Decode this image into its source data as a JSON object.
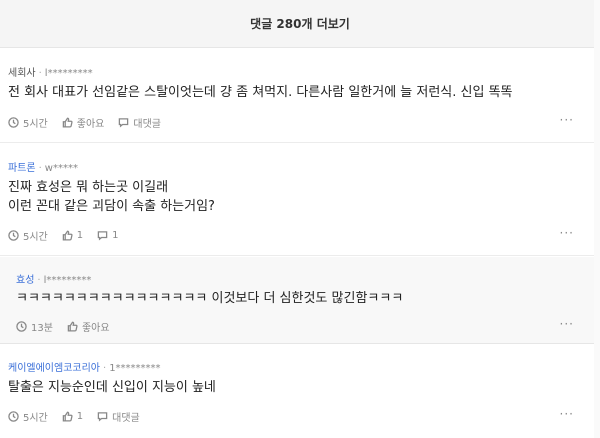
{
  "more_label": "댓글 280개 더보기",
  "comments": [
    {
      "company": "세회사",
      "user": "l*********",
      "lines": [
        "전 회사 대표가 선임같은 스탈이엇는데 걍 좀 쳐먹지. 다른사람 일한거에 늘 저런식. 신입 똑똑"
      ],
      "time": "5시간",
      "like": "좋아요",
      "reply": "대댓글",
      "more": "···"
    },
    {
      "company": "파트론",
      "user": "w*****",
      "lines": [
        "진짜 효성은 뭐 하는곳 이길래",
        "이런 꼰대 같은 괴담이 속출 하는거임?"
      ],
      "time": "5시간",
      "like": "1",
      "reply": "1",
      "more": "···"
    },
    {
      "company": "효성",
      "user": "l*********",
      "lines": [
        "ㅋㅋㅋㅋㅋㅋㅋㅋㅋㅋㅋㅋㅋㅋㅋㅋ 이것보다 더 심한것도 많긴함ㅋㅋㅋ"
      ],
      "time": "13분",
      "like": "좋아요",
      "more": "···"
    },
    {
      "company": "케이엘에이엠코코리아",
      "user": "1*********",
      "lines": [
        "탈출은 지능순인데 신입이 지능이 높네"
      ],
      "time": "5시간",
      "like": "1",
      "reply": "대댓글",
      "more": "···"
    }
  ]
}
